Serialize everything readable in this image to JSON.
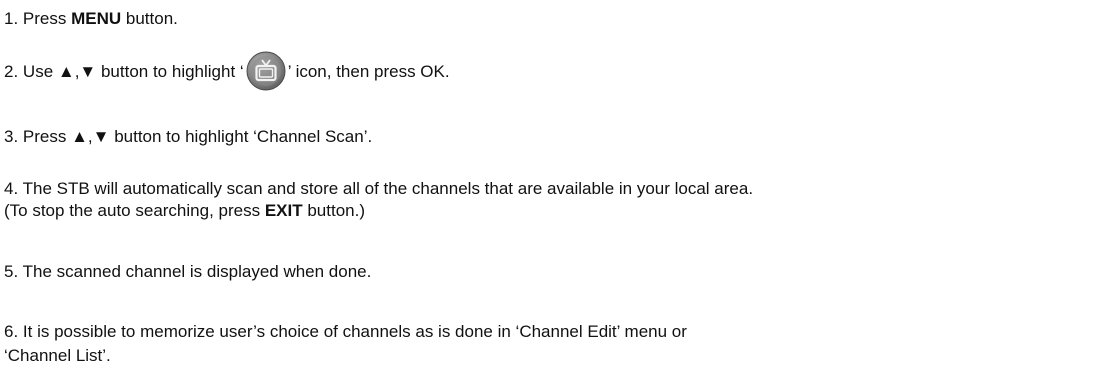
{
  "steps": [
    {
      "number": "1.",
      "pre": "Press ",
      "bold": "MENU",
      "post": " button."
    },
    {
      "number": "2.",
      "pre": "Use ▲,▼ button to highlight ‘",
      "icon": "tv-icon",
      "post": "’ icon, then press OK."
    },
    {
      "number": "3.",
      "text": "Press ▲,▼ button to highlight ‘Channel Scan’."
    },
    {
      "number": "4.",
      "line1": "The STB will automatically scan and store all of the channels that are available in your local area.",
      "line2_pre": "(To stop the auto searching, press ",
      "line2_bold": "EXIT",
      "line2_post": " button.)"
    },
    {
      "number": "5.",
      "text": "The scanned channel is displayed when done."
    },
    {
      "number": "6.",
      "line1": "It is possible to memorize user’s choice of channels as is done in ‘Channel Edit’ menu or",
      "line2": "‘Channel List’."
    }
  ],
  "colors": {
    "text": "#111111",
    "icon_outer": "#6b6b6b",
    "icon_inner": "#9a9a9a",
    "icon_glyph": "#f2f2f2"
  }
}
